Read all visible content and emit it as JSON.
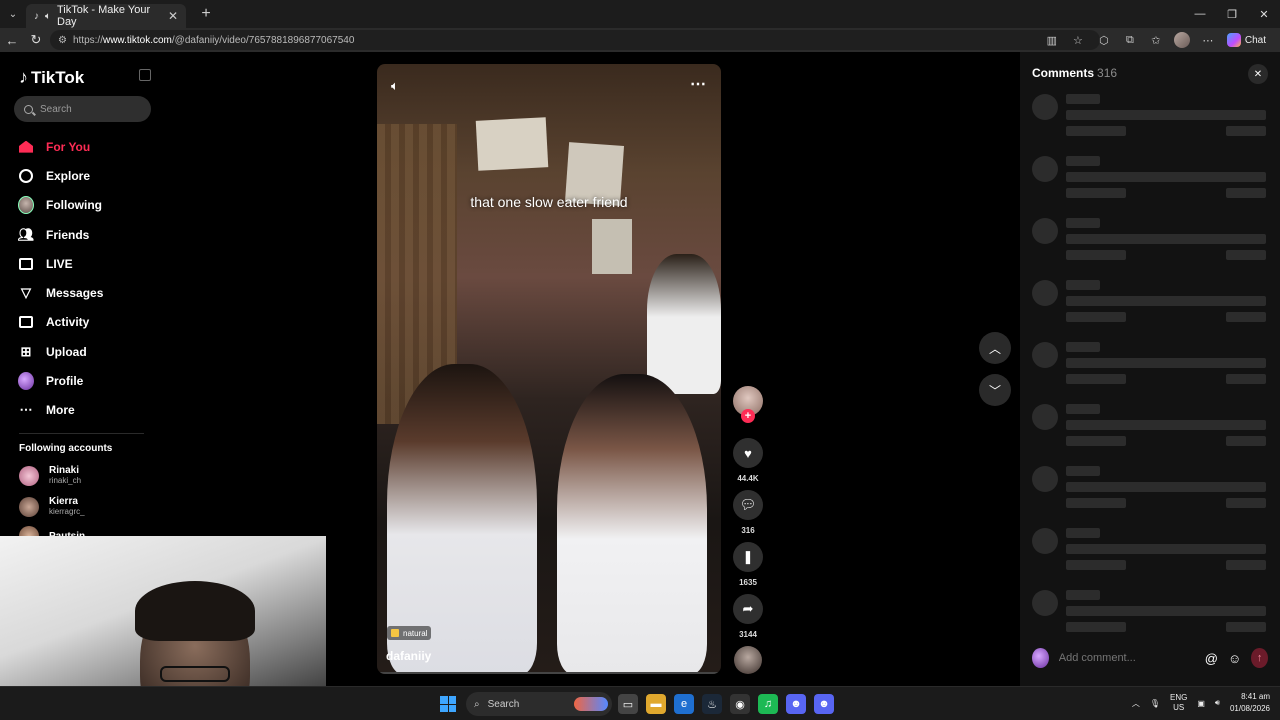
{
  "browser": {
    "tab_title": "TikTok - Make Your Day",
    "url_prefix": "https://",
    "url_host": "www.tiktok.com",
    "url_path": "/@dafaniiy/video/7657881896877067540",
    "chat_label": "Chat"
  },
  "sidebar": {
    "logo_text": "TikTok",
    "search_placeholder": "Search",
    "nav": [
      {
        "label": "For You",
        "icon": "home-icon"
      },
      {
        "label": "Explore",
        "icon": "compass-icon"
      },
      {
        "label": "Following",
        "icon": "following-avatar-icon"
      },
      {
        "label": "Friends",
        "icon": "friends-icon"
      },
      {
        "label": "LIVE",
        "icon": "live-icon"
      },
      {
        "label": "Messages",
        "icon": "send-icon"
      },
      {
        "label": "Activity",
        "icon": "activity-icon"
      },
      {
        "label": "Upload",
        "icon": "plus-box-icon"
      },
      {
        "label": "Profile",
        "icon": "profile-avatar-icon"
      },
      {
        "label": "More",
        "icon": "ellipsis-icon"
      }
    ],
    "following_header": "Following accounts",
    "accounts": [
      {
        "name": "Rinaki",
        "handle": "rinaki_ch"
      },
      {
        "name": "Kierra",
        "handle": "kierragrc_"
      },
      {
        "name": "Pautsin",
        "handle": ""
      }
    ]
  },
  "video": {
    "caption": "that one slow eater friend",
    "tag": "natural",
    "author": "dafaniiy"
  },
  "actions": {
    "likes": "44.4K",
    "comments": "316",
    "saves": "1635",
    "shares": "3144"
  },
  "comments_panel": {
    "title": "Comments",
    "count": "316",
    "input_placeholder": "Add comment..."
  },
  "taskbar": {
    "search_label": "Search",
    "lang_top": "ENG",
    "lang_bottom": "US",
    "time": "8:41 am",
    "date": "01/08/2026"
  },
  "colors": {
    "accent": "#fe2c55",
    "background": "#000000",
    "panel": "#121212"
  }
}
